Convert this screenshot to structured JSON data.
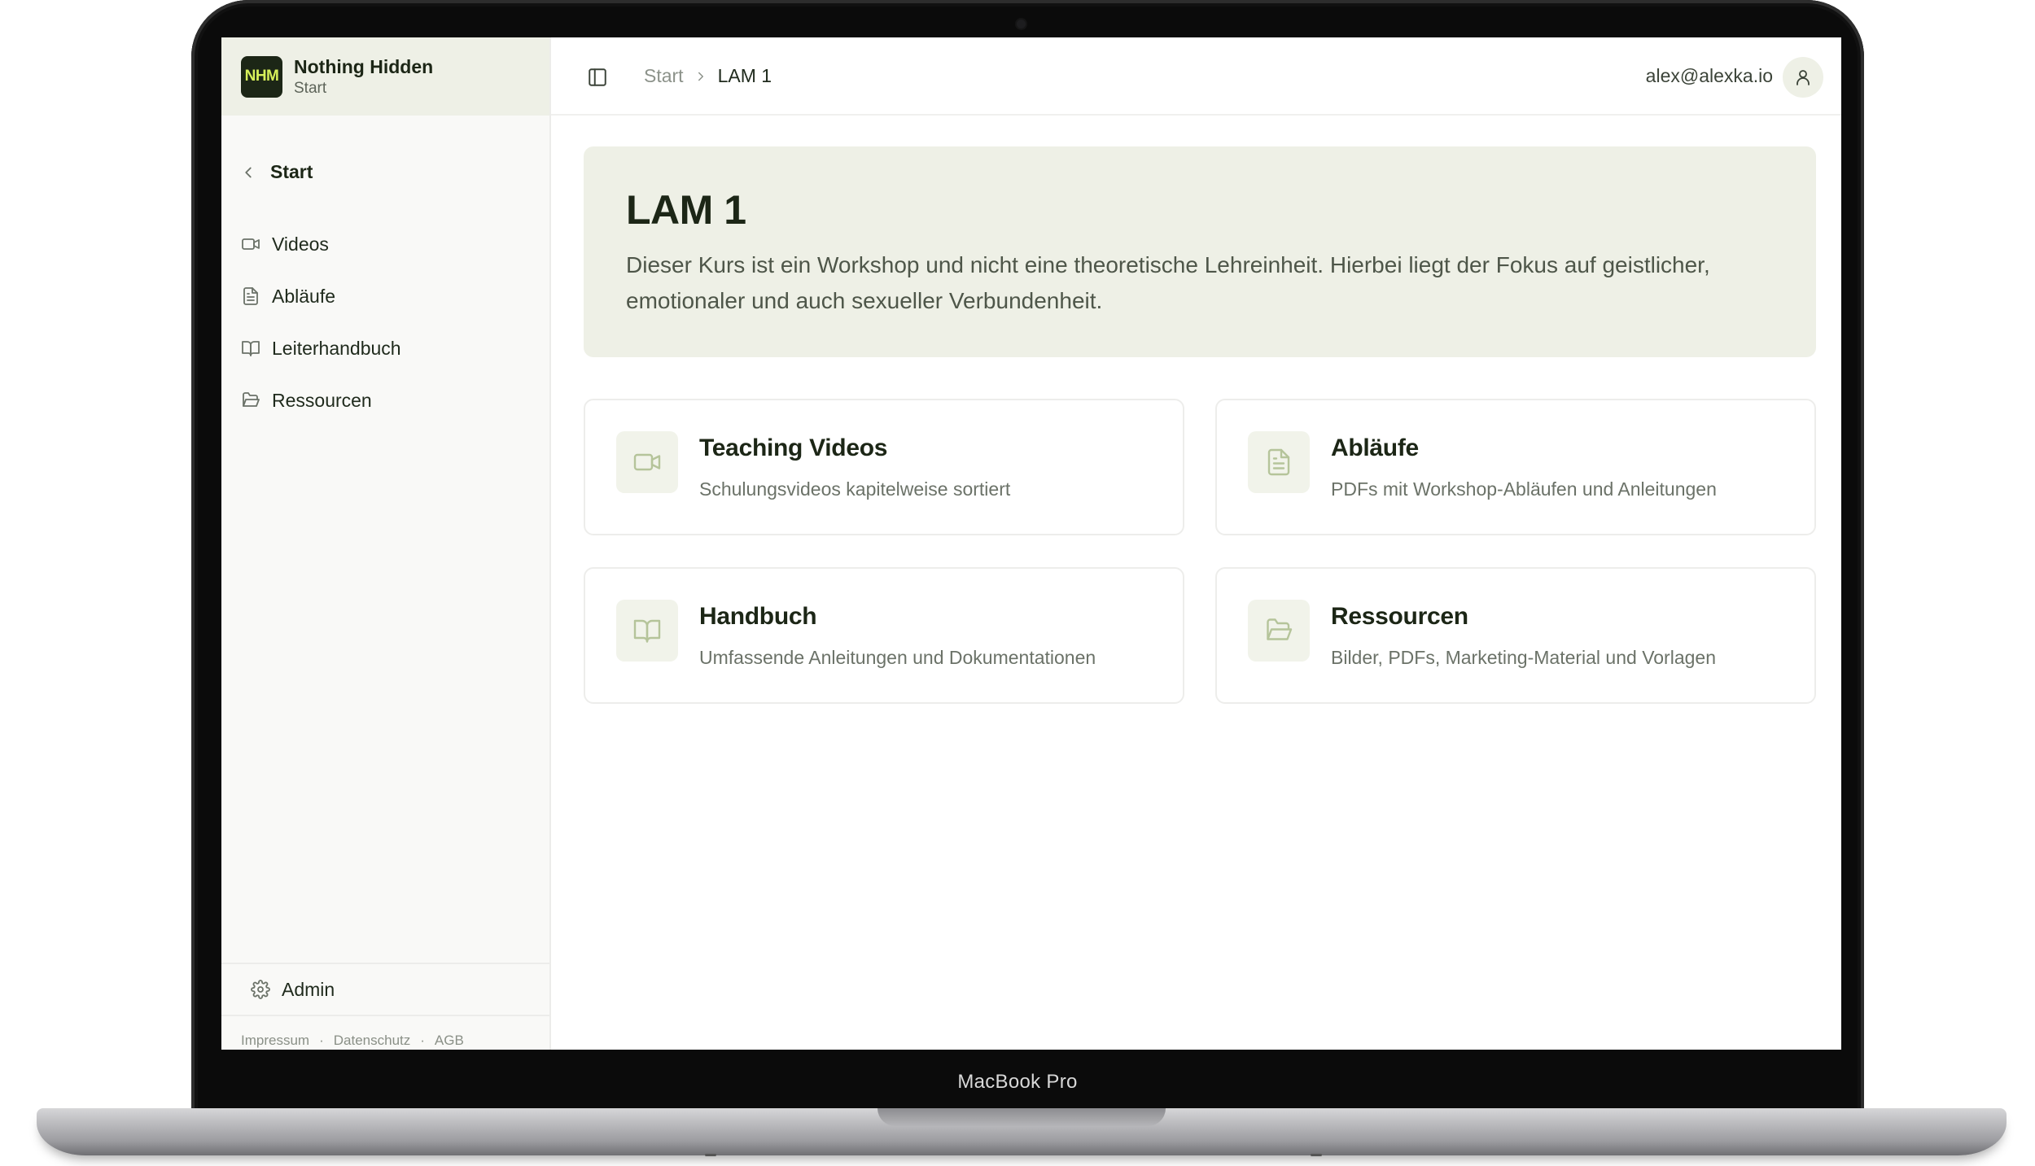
{
  "device": {
    "label": "MacBook Pro"
  },
  "brand": {
    "logo_text": "NHM",
    "title": "Nothing Hidden",
    "subtitle": "Start"
  },
  "sidebar": {
    "back_label": "Start",
    "items": [
      {
        "label": "Videos",
        "icon": "video-icon"
      },
      {
        "label": "Abläufe",
        "icon": "file-text-icon"
      },
      {
        "label": "Leiterhandbuch",
        "icon": "book-open-icon"
      },
      {
        "label": "Ressourcen",
        "icon": "folder-open-icon"
      }
    ],
    "admin_label": "Admin",
    "footer_links": [
      "Impressum",
      "Datenschutz",
      "AGB"
    ],
    "footer_separator": "·"
  },
  "topbar": {
    "breadcrumb": [
      "Start",
      "LAM 1"
    ],
    "user_email": "alex@alexka.io"
  },
  "hero": {
    "title": "LAM 1",
    "description": "Dieser Kurs ist ein Workshop und nicht eine theoretische Lehreinheit. Hierbei liegt der Fokus auf geistlicher, emotionaler und auch sexueller Verbundenheit."
  },
  "cards": [
    {
      "title": "Teaching Videos",
      "description": "Schulungsvideos kapitelweise sortiert",
      "icon": "video-icon"
    },
    {
      "title": "Abläufe",
      "description": "PDFs mit Workshop-Abläufen und Anleitungen",
      "icon": "file-text-icon"
    },
    {
      "title": "Handbuch",
      "description": "Umfassende Anleitungen und Dokumentationen",
      "icon": "book-open-icon"
    },
    {
      "title": "Ressourcen",
      "description": "Bilder, PDFs, Marketing-Material und Vorlagen",
      "icon": "folder-open-icon"
    }
  ],
  "colors": {
    "accent_bg": "#eef0e6",
    "brand_dark": "#1c2616",
    "logo_text": "#d7f05a",
    "icon_tint": "#b5c49a"
  }
}
